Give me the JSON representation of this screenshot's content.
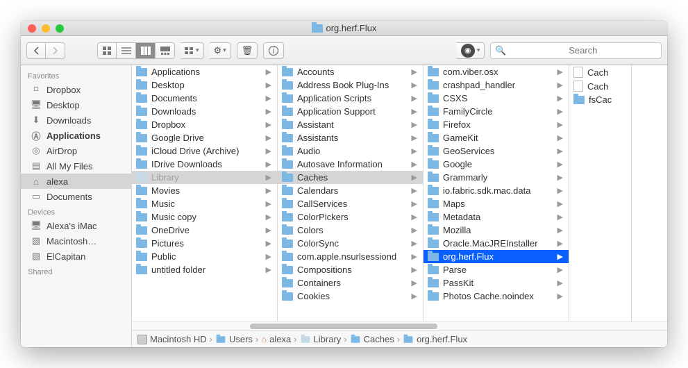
{
  "window": {
    "title": "org.herf.Flux"
  },
  "toolbar": {
    "search_placeholder": "Search"
  },
  "sidebar": {
    "sections": [
      {
        "header": "Favorites",
        "items": [
          {
            "label": "Dropbox",
            "icon": "dropbox"
          },
          {
            "label": "Desktop",
            "icon": "desktop"
          },
          {
            "label": "Downloads",
            "icon": "downloads"
          },
          {
            "label": "Applications",
            "icon": "apps",
            "bold": true
          },
          {
            "label": "AirDrop",
            "icon": "airdrop"
          },
          {
            "label": "All My Files",
            "icon": "allfiles"
          },
          {
            "label": "alexa",
            "icon": "home",
            "selected": true
          },
          {
            "label": "Documents",
            "icon": "docs"
          }
        ]
      },
      {
        "header": "Devices",
        "items": [
          {
            "label": "Alexa's iMac",
            "icon": "imac"
          },
          {
            "label": "Macintosh…",
            "icon": "hd"
          },
          {
            "label": "ElCapitan",
            "icon": "hd"
          }
        ]
      },
      {
        "header": "Shared",
        "items": []
      }
    ]
  },
  "columns": [
    {
      "items": [
        {
          "label": "Applications",
          "arrow": true
        },
        {
          "label": "Desktop",
          "arrow": true
        },
        {
          "label": "Documents",
          "arrow": true
        },
        {
          "label": "Downloads",
          "arrow": true
        },
        {
          "label": "Dropbox",
          "arrow": true
        },
        {
          "label": "Google Drive",
          "arrow": true
        },
        {
          "label": "iCloud Drive (Archive)",
          "arrow": true
        },
        {
          "label": "IDrive Downloads",
          "arrow": true
        },
        {
          "label": "Library",
          "arrow": true,
          "selected": true,
          "dim": true
        },
        {
          "label": "Movies",
          "arrow": true
        },
        {
          "label": "Music",
          "arrow": true
        },
        {
          "label": "Music copy",
          "arrow": true
        },
        {
          "label": "OneDrive",
          "arrow": true
        },
        {
          "label": "Pictures",
          "arrow": true
        },
        {
          "label": "Public",
          "arrow": true
        },
        {
          "label": "untitled folder",
          "arrow": true
        }
      ]
    },
    {
      "items": [
        {
          "label": "Accounts",
          "arrow": true
        },
        {
          "label": "Address Book Plug-Ins",
          "arrow": true
        },
        {
          "label": "Application Scripts",
          "arrow": true
        },
        {
          "label": "Application Support",
          "arrow": true
        },
        {
          "label": "Assistant",
          "arrow": true
        },
        {
          "label": "Assistants",
          "arrow": true
        },
        {
          "label": "Audio",
          "arrow": true
        },
        {
          "label": "Autosave Information",
          "arrow": true
        },
        {
          "label": "Caches",
          "arrow": true,
          "selected": true
        },
        {
          "label": "Calendars",
          "arrow": true
        },
        {
          "label": "CallServices",
          "arrow": true
        },
        {
          "label": "ColorPickers",
          "arrow": true
        },
        {
          "label": "Colors",
          "arrow": true
        },
        {
          "label": "ColorSync",
          "arrow": true
        },
        {
          "label": "com.apple.nsurlsessiond",
          "arrow": true
        },
        {
          "label": "Compositions",
          "arrow": true
        },
        {
          "label": "Containers",
          "arrow": true
        },
        {
          "label": "Cookies",
          "arrow": true
        }
      ]
    },
    {
      "items": [
        {
          "label": "com.viber.osx",
          "arrow": true
        },
        {
          "label": "crashpad_handler",
          "arrow": true
        },
        {
          "label": "CSXS",
          "arrow": true
        },
        {
          "label": "FamilyCircle",
          "arrow": true
        },
        {
          "label": "Firefox",
          "arrow": true
        },
        {
          "label": "GameKit",
          "arrow": true
        },
        {
          "label": "GeoServices",
          "arrow": true
        },
        {
          "label": "Google",
          "arrow": true
        },
        {
          "label": "Grammarly",
          "arrow": true
        },
        {
          "label": "io.fabric.sdk.mac.data",
          "arrow": true
        },
        {
          "label": "Maps",
          "arrow": true
        },
        {
          "label": "Metadata",
          "arrow": true
        },
        {
          "label": "Mozilla",
          "arrow": true
        },
        {
          "label": "Oracle.MacJREInstaller",
          "arrow": true
        },
        {
          "label": "org.herf.Flux",
          "arrow": true,
          "highlight": true
        },
        {
          "label": "Parse",
          "arrow": true
        },
        {
          "label": "PassKit",
          "arrow": true
        },
        {
          "label": "Photos Cache.noindex",
          "arrow": true
        }
      ]
    },
    {
      "items": [
        {
          "label": "Cach",
          "file": true
        },
        {
          "label": "Cach",
          "file": true
        },
        {
          "label": "fsCac",
          "arrow": false,
          "folder": true
        }
      ]
    }
  ],
  "pathbar": [
    {
      "label": "Macintosh HD",
      "icon": "hd"
    },
    {
      "label": "Users",
      "icon": "folder"
    },
    {
      "label": "alexa",
      "icon": "home"
    },
    {
      "label": "Library",
      "icon": "folder-dim"
    },
    {
      "label": "Caches",
      "icon": "folder"
    },
    {
      "label": "org.herf.Flux",
      "icon": "folder"
    }
  ]
}
